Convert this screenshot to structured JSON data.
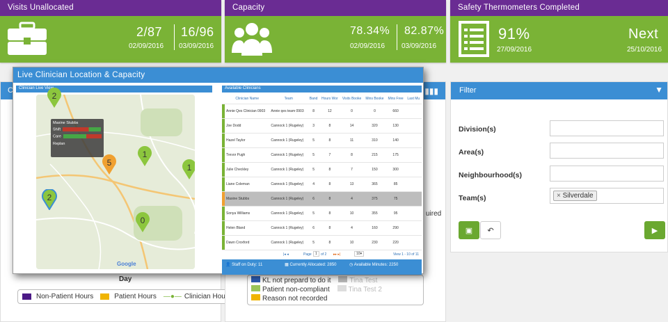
{
  "tiles": {
    "visits": {
      "title": "Visits Unallocated",
      "v1": "2/87",
      "d1": "02/09/2016",
      "v2": "16/96",
      "d2": "03/09/2016"
    },
    "capacity": {
      "title": "Capacity",
      "v1": "78.34%",
      "d1": "02/09/2016",
      "v2": "82.87%",
      "d2": "03/09/2016"
    },
    "safety": {
      "title": "Safety Thermometers Completed",
      "v1": "91%",
      "d1": "27/09/2016",
      "v2": "Next",
      "d2": "25/10/2016"
    }
  },
  "filter": {
    "title": "Filter",
    "division": "Division(s)",
    "area": "Area(s)",
    "neighbourhood": "Neighbourhood(s)",
    "team": "Team(s)",
    "team_tag": "Silverdale",
    "team_tag_close": "×"
  },
  "bg": {
    "chart_title_fragment": "C",
    "day_label": "Day",
    "required_fragment": "uired",
    "legend1": [
      "Non-Patient Hours",
      "Patient Hours",
      "Clinician Hours"
    ],
    "legend2": [
      "KL not prepard to do it",
      "Tina Test",
      "Patient non-compliant",
      "Tina Test 2",
      "Reason not recorded"
    ]
  },
  "modal": {
    "title": "Live Clinician Location & Capacity",
    "left_sub": "Clinician Live View",
    "right_sub": "Available Clinicians",
    "popup": {
      "name": "Maxine Stubbs",
      "shift": "Shift",
      "care": "Care",
      "replan": "Replan"
    },
    "pins": [
      "2",
      "5",
      "1",
      "2",
      "0"
    ],
    "map_watermark": "Google",
    "columns": [
      "Clinician Name",
      "Team",
      "Band",
      "Hours Wor",
      "Visits Booke",
      "Mins Booke",
      "Mins Free",
      "Last Mu"
    ],
    "rows": [
      [
        "Annie Qes Clinician 0903",
        "Annie qes team 0903",
        "8",
        "12",
        "0",
        "0",
        "660"
      ],
      [
        "Joe Dodd",
        "Cannock 1 (Rugeley)",
        "3",
        "8",
        "14",
        "320",
        "130"
      ],
      [
        "Hazel Taylor",
        "Cannock 1 (Rugeley)",
        "5",
        "8",
        "11",
        "310",
        "140"
      ],
      [
        "Trevor Pugh",
        "Cannock 1 (Rugeley)",
        "5",
        "7",
        "8",
        "215",
        "175"
      ],
      [
        "Julie Checkley",
        "Cannock 1 (Rugeley)",
        "5",
        "8",
        "7",
        "150",
        "300"
      ],
      [
        "Liane Coleman",
        "Cannock 1 (Rugeley)",
        "4",
        "8",
        "13",
        "365",
        "85"
      ],
      [
        "Maxine Stubbs",
        "Cannock 1 (Rugeley)",
        "6",
        "8",
        "4",
        "375",
        "75"
      ],
      [
        "Sonya Williams",
        "Cannock 1 (Rugeley)",
        "5",
        "8",
        "10",
        "355",
        "95"
      ],
      [
        "Helen Bland",
        "Cannock 1 (Rugeley)",
        "6",
        "8",
        "4",
        "160",
        "290"
      ],
      [
        "Dawn Croxford",
        "Cannock 1 (Rugeley)",
        "5",
        "8",
        "10",
        "230",
        "220"
      ]
    ],
    "pager": {
      "page": "Page",
      "page_num": "1",
      "of": "of 2",
      "rows": "10",
      "view": "View 1 - 10 of 11"
    },
    "footer": {
      "staff": "Staff on Duty: 11",
      "allocated": "Currently Allocated: 2850",
      "available": "Available Minutes: 2250"
    }
  },
  "colors": {
    "green": "#7ab336",
    "purple": "#6a2c93",
    "blue": "#3b8ed4",
    "orange": "#f0a030"
  }
}
